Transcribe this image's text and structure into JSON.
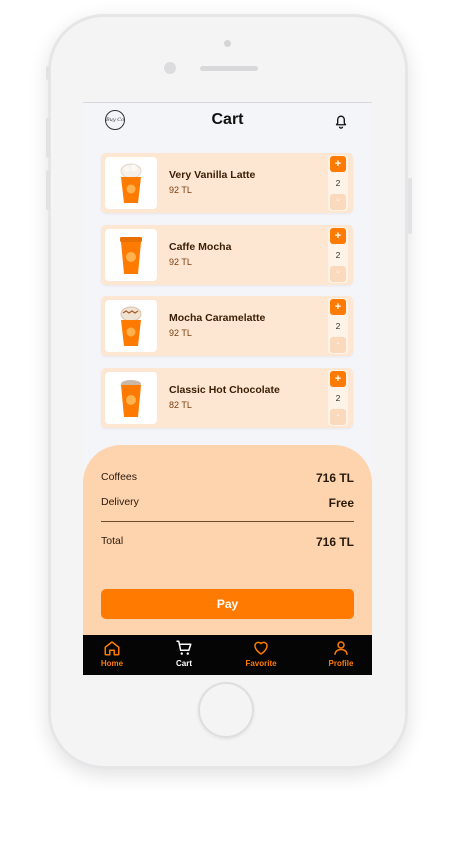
{
  "header": {
    "title": "Cart",
    "logo_text": "Buy Coffee"
  },
  "cart": {
    "items": [
      {
        "name": "Very Vanilla Latte",
        "price": "92 TL",
        "qty": "2",
        "plus": "+",
        "minus": "-"
      },
      {
        "name": "Caffe Mocha",
        "price": "92 TL",
        "qty": "2",
        "plus": "+",
        "minus": "-"
      },
      {
        "name": "Mocha Caramelatte",
        "price": "92 TL",
        "qty": "2",
        "plus": "+",
        "minus": "-"
      },
      {
        "name": "Classic Hot Chocolate",
        "price": "82 TL",
        "qty": "2",
        "plus": "+",
        "minus": "-"
      }
    ]
  },
  "summary": {
    "coffees_label": "Coffees",
    "coffees_value": "716 TL",
    "delivery_label": "Delivery",
    "delivery_value": "Free",
    "total_label": "Total",
    "total_value": "716 TL",
    "pay_label": "Pay"
  },
  "nav": {
    "items": [
      {
        "label": "Home",
        "icon": "home-icon",
        "active": false
      },
      {
        "label": "Cart",
        "icon": "cart-icon",
        "active": true
      },
      {
        "label": "Favorite",
        "icon": "heart-icon",
        "active": false
      },
      {
        "label": "Profile",
        "icon": "user-icon",
        "active": false
      }
    ]
  },
  "colors": {
    "accent": "#ff7a00",
    "card": "#fde6d2",
    "summary_bg": "#fdd4ae",
    "nav_bg": "#050505"
  }
}
